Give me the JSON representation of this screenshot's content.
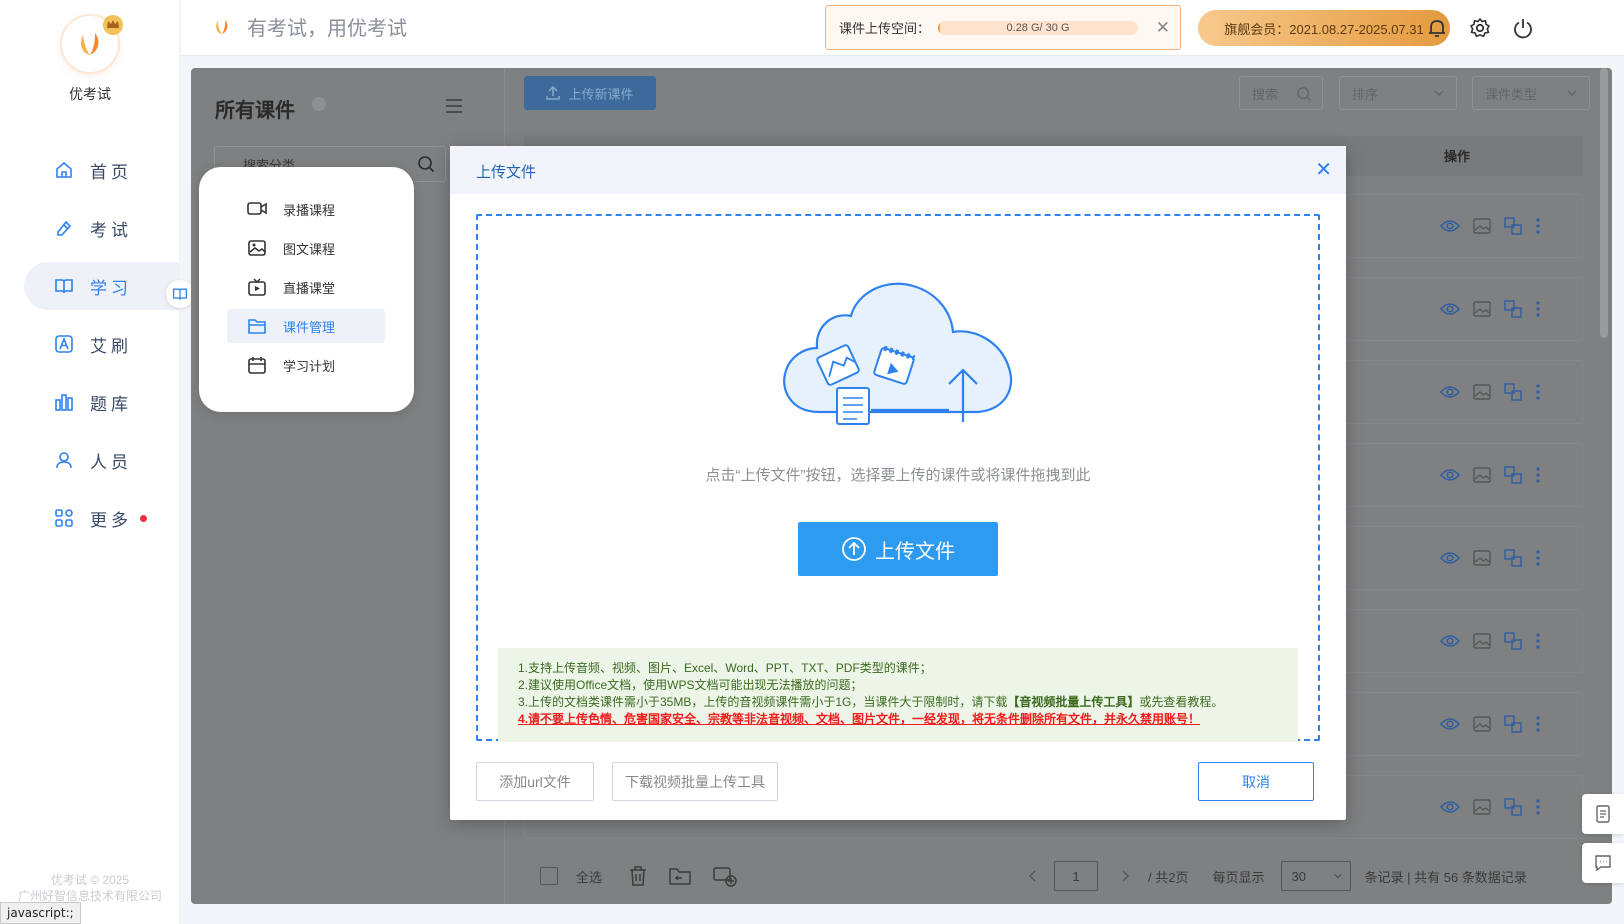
{
  "app": {
    "name": "优考试",
    "slogan": "有考试，用优考试",
    "copyright": "优考试 © 2025",
    "company": "广州好智信息技术有限公司"
  },
  "status_bar": "javascript:;",
  "nav": [
    {
      "label": "首页",
      "icon": "home-icon"
    },
    {
      "label": "考试",
      "icon": "exam-icon"
    },
    {
      "label": "学习",
      "icon": "book-icon",
      "active": true
    },
    {
      "label": "艾刷",
      "icon": "ai-brush-icon"
    },
    {
      "label": "题库",
      "icon": "bank-icon"
    },
    {
      "label": "人员",
      "icon": "user-icon"
    },
    {
      "label": "更多",
      "icon": "more-icon",
      "dot": true
    }
  ],
  "header": {
    "quota_label": "课件上传空间：",
    "quota_text": "0.28 G/ 30 G",
    "quota_used": 0.0093,
    "member": "旗舰会员：2021.08.27-2025.07.31"
  },
  "submenu": [
    {
      "label": "录播课程",
      "icon": "video-icon"
    },
    {
      "label": "图文课程",
      "icon": "image-icon"
    },
    {
      "label": "直播课堂",
      "icon": "live-icon"
    },
    {
      "label": "课件管理",
      "icon": "folder-icon",
      "active": true
    },
    {
      "label": "学习计划",
      "icon": "calendar-icon"
    }
  ],
  "left_panel": {
    "title": "所有课件",
    "search_placeholder": "搜索分类"
  },
  "toolbar": {
    "upload_new": "上传新课件",
    "search": "搜索",
    "sort": "排序",
    "type": "课件类型"
  },
  "table": {
    "ops_header": "操作",
    "rows": 8
  },
  "bottom": {
    "select_all": "全选",
    "page": "1",
    "total_pages": "/ 共2页",
    "per_page_label": "每页显示",
    "per_page": "30",
    "records": "条记录 | 共有 56 条数据记录"
  },
  "modal": {
    "title": "上传文件",
    "hint": "点击“上传文件”按钮，选择要上传的课件或将课件拖拽到此",
    "upload_button": "上传文件",
    "note1": "1.支持上传音频、视频、图片、Excel、Word、PPT、TXT、PDF类型的课件；",
    "note2": "2.建议使用Office文档，使用WPS文档可能出现无法播放的问题；",
    "note3_a": "3.上传的文档类课件需小于35MB，上传的音视频课件需小于1G，当课件大于限制时，请下载",
    "note3_b": "【音视频批量上传工具】",
    "note3_c": "或先查看教程。",
    "note4": "4.请不要上传色情、危害国家安全、宗教等非法音视频、文档、图片文件，一经发现，将无条件删除所有文件，并永久禁用账号！",
    "add_url": "添加url文件",
    "download_tool": "下载视频批量上传工具",
    "cancel": "取消"
  },
  "colors": {
    "primary": "#2d82f0",
    "warning": "#f21c1c",
    "member_gold": "#e49a3e"
  }
}
